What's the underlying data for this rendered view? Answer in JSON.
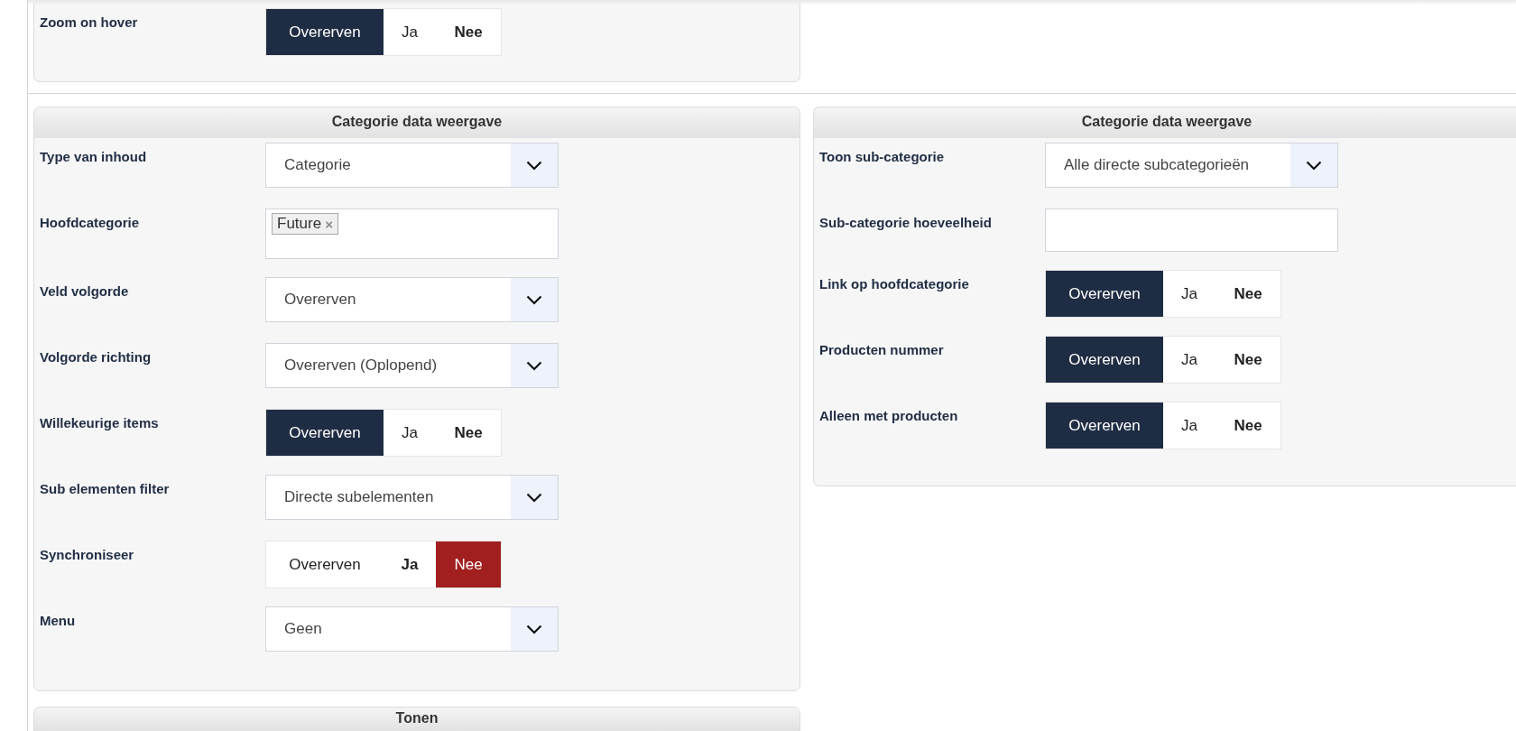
{
  "top_panel": {
    "rows": [
      {
        "kind": "toggle",
        "label": "Zoom on hover",
        "options": [
          {
            "label": "Overerven",
            "kind": "inherit",
            "selected": true,
            "bold": false
          },
          {
            "label": "Ja",
            "kind": "yes",
            "selected": false,
            "bold": false
          },
          {
            "label": "Nee",
            "kind": "no",
            "selected": false,
            "bold": true
          }
        ]
      }
    ]
  },
  "panels": [
    {
      "title": "Categorie data weergave",
      "rows": [
        {
          "kind": "select",
          "label": "Type van inhoud",
          "value": "Categorie"
        },
        {
          "kind": "tags",
          "label": "Hoofdcategorie",
          "tags": [
            {
              "label": "Future",
              "remove": "×"
            }
          ]
        },
        {
          "kind": "select",
          "label": "Veld volgorde",
          "value": "Overerven"
        },
        {
          "kind": "select",
          "label": "Volgorde richting",
          "value": "Overerven (Oplopend)"
        },
        {
          "kind": "toggle",
          "label": "Willekeurige items",
          "options": [
            {
              "label": "Overerven",
              "kind": "inherit",
              "selected": true,
              "bold": false
            },
            {
              "label": "Ja",
              "kind": "yes",
              "selected": false,
              "bold": false
            },
            {
              "label": "Nee",
              "kind": "no",
              "selected": false,
              "bold": true
            }
          ]
        },
        {
          "kind": "select",
          "label": "Sub elementen filter",
          "value": "Directe subelementen"
        },
        {
          "kind": "toggle",
          "label": "Synchroniseer",
          "options": [
            {
              "label": "Overerven",
              "kind": "inherit",
              "selected": false,
              "bold": false
            },
            {
              "label": "Ja",
              "kind": "yes",
              "selected": false,
              "bold": true
            },
            {
              "label": "Nee",
              "kind": "no",
              "selected": true,
              "bold": false
            }
          ]
        },
        {
          "kind": "select",
          "label": "Menu",
          "value": "Geen"
        }
      ]
    },
    {
      "title": "Categorie data weergave",
      "rows": [
        {
          "kind": "select",
          "label": "Toon sub-categorie",
          "value": "Alle directe subcategorieën"
        },
        {
          "kind": "input",
          "label": "Sub-categorie hoeveelheid"
        },
        {
          "kind": "toggle",
          "label": "Link op hoofdcategorie",
          "options": [
            {
              "label": "Overerven",
              "kind": "inherit",
              "selected": true,
              "bold": false
            },
            {
              "label": "Ja",
              "kind": "yes",
              "selected": false,
              "bold": false
            },
            {
              "label": "Nee",
              "kind": "no",
              "selected": false,
              "bold": true
            }
          ]
        },
        {
          "kind": "toggle",
          "label": "Producten nummer",
          "options": [
            {
              "label": "Overerven",
              "kind": "inherit",
              "selected": true,
              "bold": false
            },
            {
              "label": "Ja",
              "kind": "yes",
              "selected": false,
              "bold": false
            },
            {
              "label": "Nee",
              "kind": "no",
              "selected": false,
              "bold": true
            }
          ]
        },
        {
          "kind": "toggle",
          "label": "Alleen met producten",
          "options": [
            {
              "label": "Overerven",
              "kind": "inherit",
              "selected": true,
              "bold": false
            },
            {
              "label": "Ja",
              "kind": "yes",
              "selected": false,
              "bold": false
            },
            {
              "label": "Nee",
              "kind": "no",
              "selected": false,
              "bold": true
            }
          ]
        }
      ]
    }
  ],
  "bottom_panel": {
    "title": "Tonen"
  }
}
